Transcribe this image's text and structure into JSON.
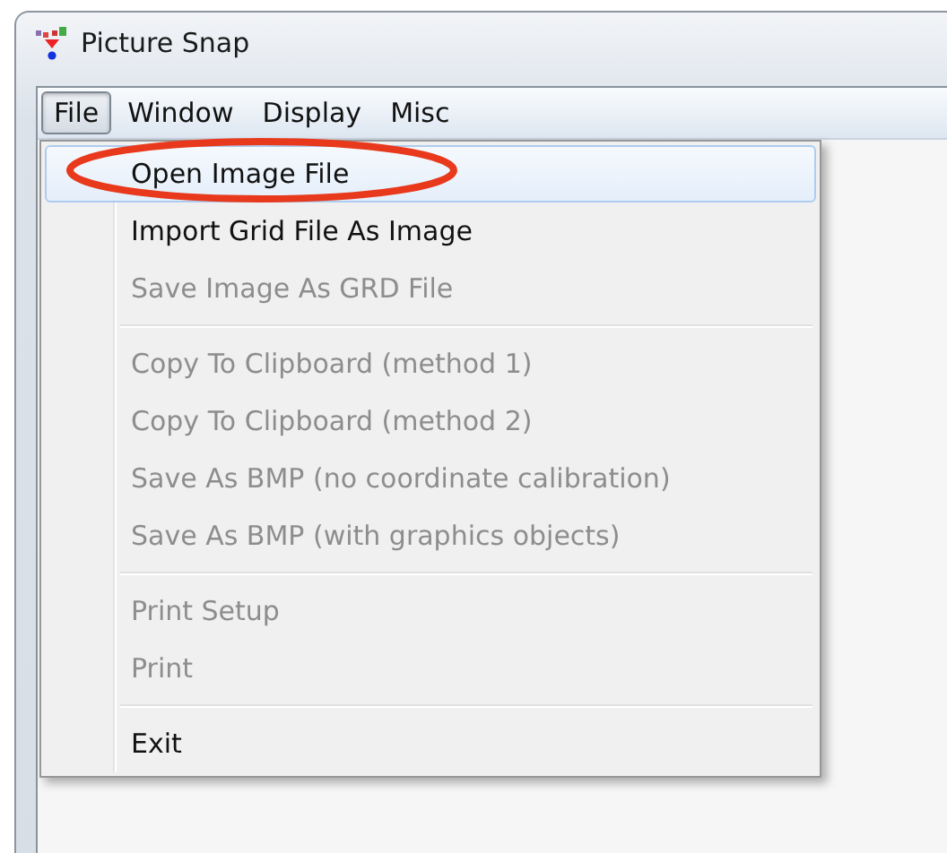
{
  "window": {
    "title": "Picture Snap"
  },
  "menu_bar": [
    {
      "label": "File",
      "selected": true
    },
    {
      "label": "Window",
      "selected": false
    },
    {
      "label": "Display",
      "selected": false
    },
    {
      "label": "Misc",
      "selected": false
    }
  ],
  "file_menu": [
    {
      "kind": "item",
      "label": "Open Image File",
      "disabled": false,
      "selected": true,
      "circled": true
    },
    {
      "kind": "item",
      "label": "Import Grid File As Image",
      "disabled": false,
      "selected": false,
      "circled": false
    },
    {
      "kind": "item",
      "label": "Save Image As GRD File",
      "disabled": true,
      "selected": false,
      "circled": false
    },
    {
      "kind": "separator"
    },
    {
      "kind": "item",
      "label": "Copy To Clipboard (method 1)",
      "disabled": true,
      "selected": false,
      "circled": false
    },
    {
      "kind": "item",
      "label": "Copy To Clipboard (method 2)",
      "disabled": true,
      "selected": false,
      "circled": false
    },
    {
      "kind": "item",
      "label": "Save As BMP (no coordinate calibration)",
      "disabled": true,
      "selected": false,
      "circled": false
    },
    {
      "kind": "item",
      "label": "Save As BMP (with graphics objects)",
      "disabled": true,
      "selected": false,
      "circled": false
    },
    {
      "kind": "separator"
    },
    {
      "kind": "item",
      "label": "Print Setup",
      "disabled": true,
      "selected": false,
      "circled": false
    },
    {
      "kind": "item",
      "label": "Print",
      "disabled": true,
      "selected": false,
      "circled": false
    },
    {
      "kind": "separator"
    },
    {
      "kind": "item",
      "label": "Exit",
      "disabled": false,
      "selected": false,
      "circled": false
    }
  ]
}
